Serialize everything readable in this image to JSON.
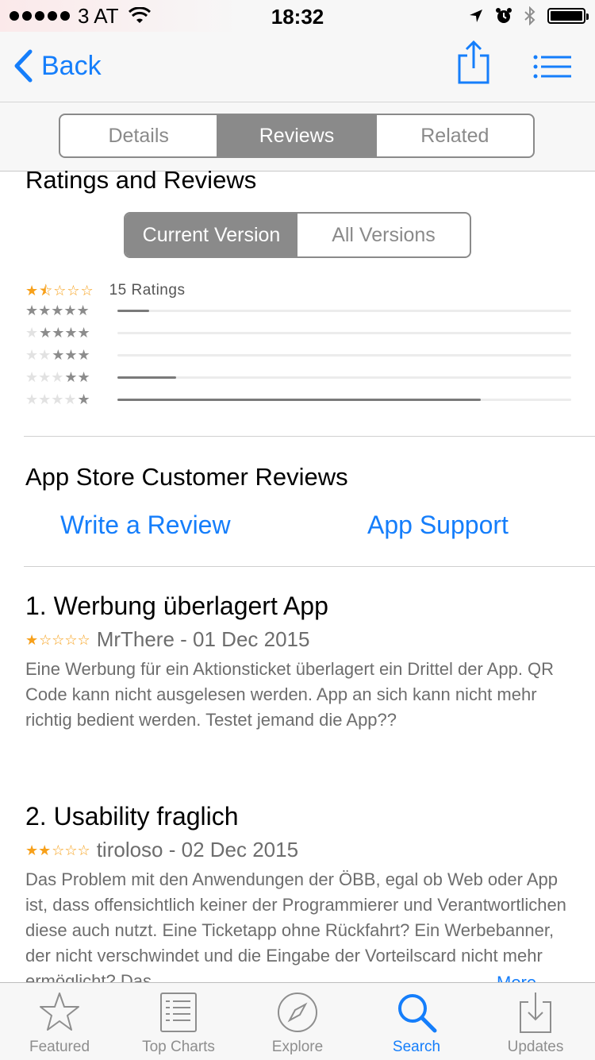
{
  "status": {
    "carrier": "3 AT",
    "time": "18:32"
  },
  "nav": {
    "back_label": "Back"
  },
  "tabs_top": [
    {
      "label": "Details",
      "active": false
    },
    {
      "label": "Reviews",
      "active": true
    },
    {
      "label": "Related",
      "active": false
    }
  ],
  "ratings": {
    "heading": "Ratings and Reviews",
    "version_tabs": [
      {
        "label": "Current Version",
        "active": true
      },
      {
        "label": "All Versions",
        "active": false
      }
    ],
    "count_label": "15 Ratings",
    "average_stars": 1.5,
    "distribution": [
      {
        "stars": 5,
        "fraction": 0.07
      },
      {
        "stars": 4,
        "fraction": 0.0
      },
      {
        "stars": 3,
        "fraction": 0.0
      },
      {
        "stars": 2,
        "fraction": 0.13
      },
      {
        "stars": 1,
        "fraction": 0.8
      }
    ]
  },
  "customer": {
    "heading": "App Store Customer Reviews",
    "write_review": "Write a Review",
    "app_support": "App Support"
  },
  "reviews": [
    {
      "title": "1. Werbung überlagert App",
      "stars": 1,
      "author": "MrThere - 01 Dec 2015",
      "body": "Eine Werbung für ein Aktionsticket überlagert ein Drittel der App. QR Code kann nicht ausgelesen werden. App an sich kann nicht mehr richtig bedient werden. Testet jemand die App??"
    },
    {
      "title": "2. Usability fraglich",
      "stars": 2,
      "author": "tiroloso - 02 Dec 2015",
      "body": "Das Problem mit den Anwendungen der ÖBB, egal ob Web oder App ist, dass offensichtlich keiner der Programmierer und Verantwortlichen diese auch nutzt. Eine Ticketapp ohne Rückfahrt? Ein Werbebanner, der nicht verschwindet und die Eingabe der Vorteilscard nicht mehr ermöglicht? Das…",
      "more": "More"
    }
  ],
  "tabbar": [
    {
      "label": "Featured",
      "icon": "star-icon",
      "active": false
    },
    {
      "label": "Top Charts",
      "icon": "list-icon",
      "active": false
    },
    {
      "label": "Explore",
      "icon": "compass-icon",
      "active": false
    },
    {
      "label": "Search",
      "icon": "search-icon",
      "active": true
    },
    {
      "label": "Updates",
      "icon": "download-icon",
      "active": false
    }
  ],
  "colors": {
    "accent": "#157efb",
    "star": "#f7a01a",
    "segment": "#8a8a8a"
  }
}
